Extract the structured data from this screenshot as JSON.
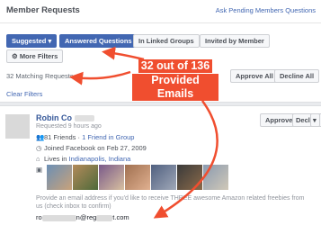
{
  "header": {
    "title": "Member Requests",
    "ask_link": "Ask Pending Members Questions"
  },
  "filters": {
    "suggested": "Suggested",
    "answered_questions": "Answered Questions",
    "in_linked_groups": "In Linked Groups",
    "invited_by_member": "Invited by Member",
    "more_filters": "More Filters"
  },
  "results": {
    "matching": "32 Matching Requests",
    "clear_filters": "Clear Filters",
    "approve_all": "Approve All",
    "decline_all": "Decline All"
  },
  "annotation": {
    "line1": "32 out of 136",
    "line2": "Provided Emails"
  },
  "request": {
    "name_visible": "Robin Co",
    "requested": "Requested 9 hours ago",
    "friends": "81 Friends",
    "friends_sep": " · ",
    "friend_in_group": "1 Friend in Group",
    "joined": "Joined Facebook on Feb 27, 2009",
    "lives_prefix": "Lives in ",
    "lives_city": "Indianapolis, Indiana",
    "approve": "Approve",
    "decline": "Decline",
    "question": "Provide an email address if you'd like to receive THREE awesome Amazon related freebies from us (check inbox to confirm)",
    "answer_prefix": "ro",
    "answer_mid": "n@reg",
    "answer_suffix": "t.com"
  },
  "colors": {
    "accent": "#4267b2",
    "annotation": "#f04e2f"
  }
}
